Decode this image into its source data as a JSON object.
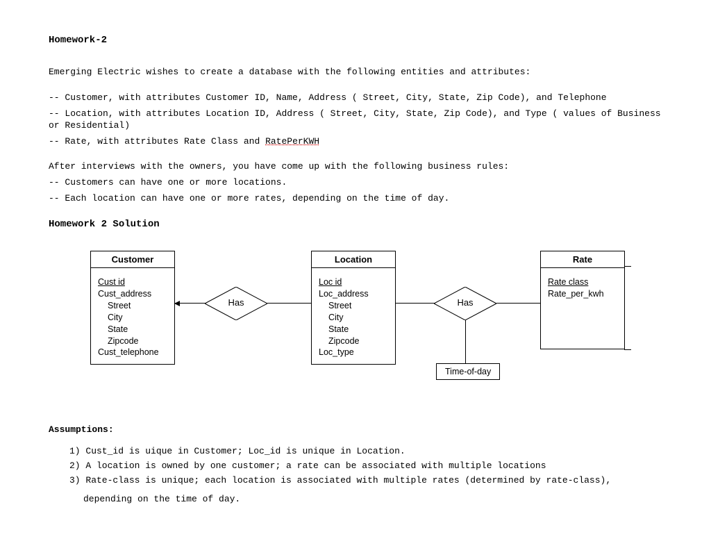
{
  "title": "Homework-2",
  "intro": "Emerging Electric wishes to create a database with the following entities and attributes:",
  "bullets": {
    "b1": "-- Customer, with attributes Customer ID, Name, Address ( Street, City, State, Zip Code), and Telephone",
    "b2": "-- Location, with attributes Location ID, Address ( Street, City, State, Zip Code), and Type ( values of Business or Residential)",
    "b3a": "-- Rate, with attributes Rate Class and ",
    "b3b": "RatePerKWH"
  },
  "rules_intro": "After interviews with the owners, you have come up with the following business rules:",
  "rules": {
    "r1": "-- Customers can have one or more locations.",
    "r2": "-- Each location can have one or more rates, depending on the time of day."
  },
  "solution_title": "Homework 2 Solution",
  "entities": {
    "customer": {
      "title": "Customer",
      "attrs": {
        "id": "Cust id",
        "addr": "Cust_address",
        "street": "Street",
        "city": "City",
        "state": "State",
        "zip": "Zipcode",
        "tel": "Cust_telephone"
      }
    },
    "location": {
      "title": "Location",
      "attrs": {
        "id": "Loc id",
        "addr": "Loc_address",
        "street": "Street",
        "city": "City",
        "state": "State",
        "zip": "Zipcode",
        "type": "Loc_type"
      }
    },
    "rate": {
      "title": "Rate",
      "attrs": {
        "class": "Rate class",
        "per": "Rate_per_kwh"
      }
    }
  },
  "rel": {
    "has1": "Has",
    "has2": "Has",
    "tod": "Time-of-day"
  },
  "assumptions_label": "Assumptions:",
  "assumptions": {
    "a1": "1) Cust_id is uique in Customer; Loc_id is unique in Location.",
    "a2": "2) A location is owned by one customer; a rate can be associated with multiple locations",
    "a3": "3) Rate-class is unique; each location is associated with multiple rates (determined by rate-class),",
    "a3b": "depending on the time of day."
  }
}
